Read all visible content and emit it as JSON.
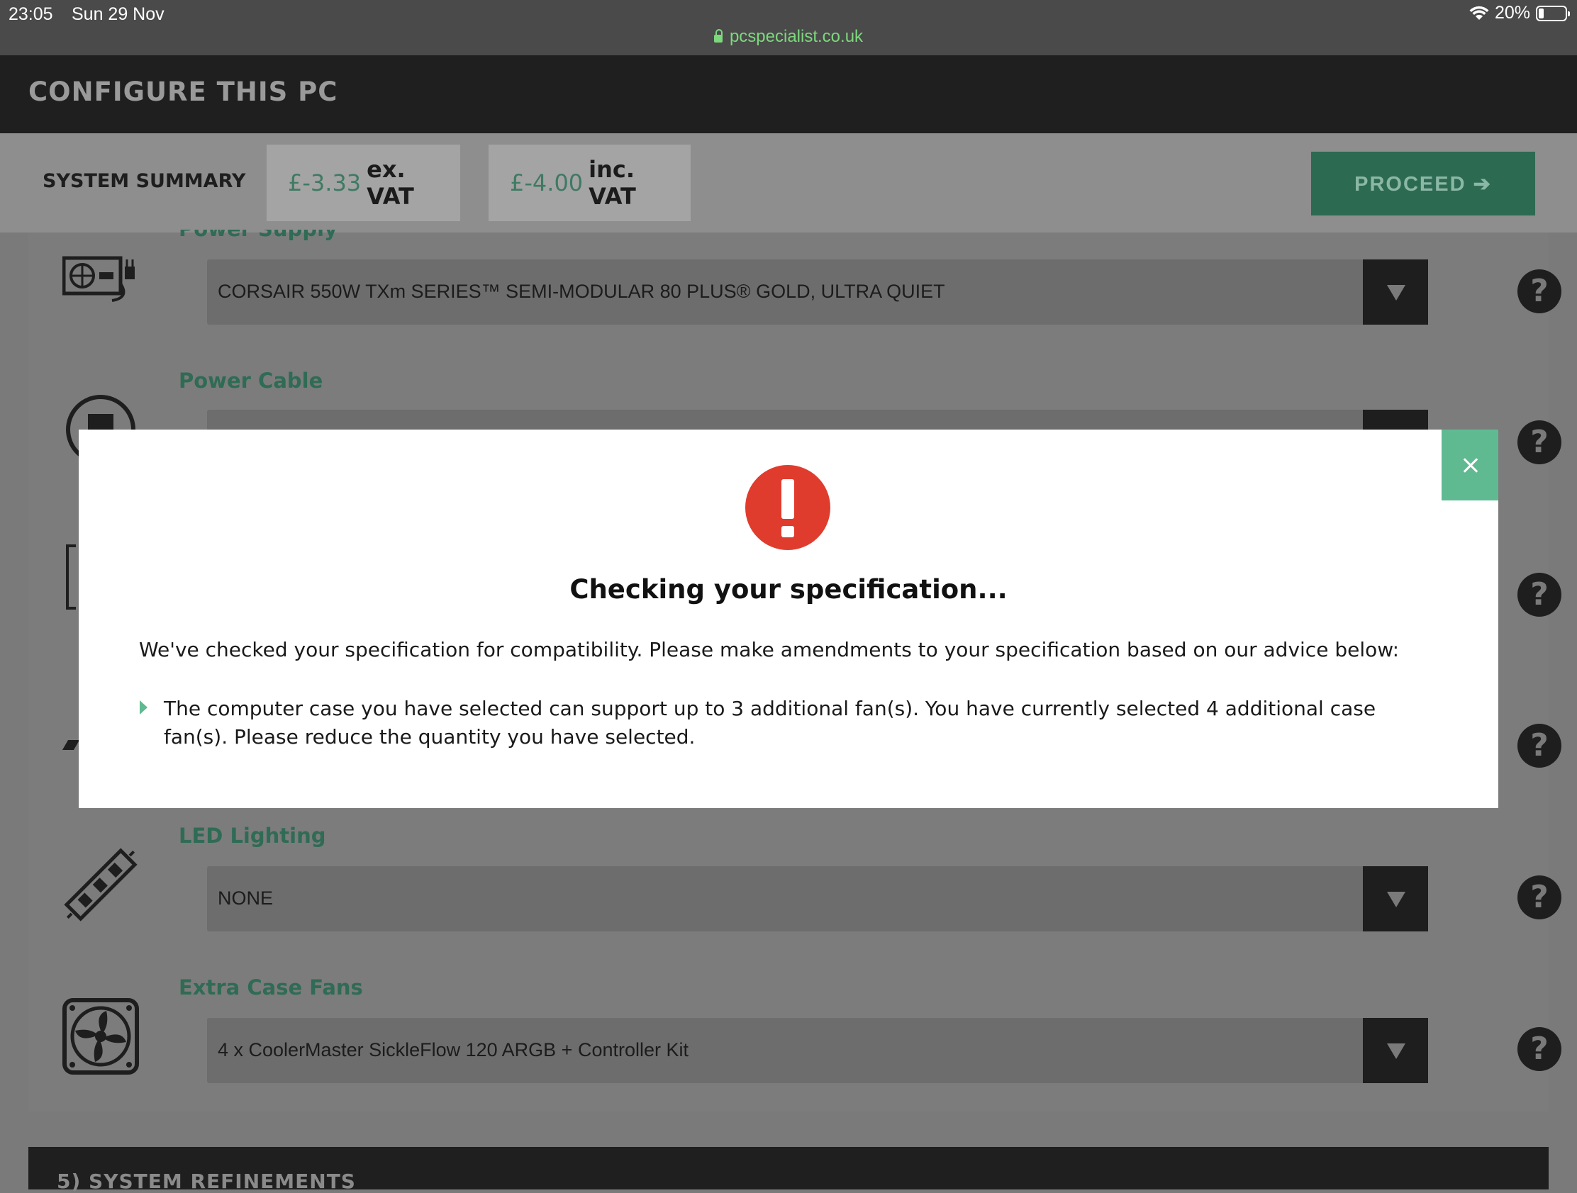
{
  "status_bar": {
    "time": "23:05",
    "date": "Sun 29 Nov",
    "battery": "20%",
    "battery_level": 0.2,
    "url": "pcspecialist.co.uk"
  },
  "header": {
    "title": "CONFIGURE THIS PC"
  },
  "summary": {
    "label": "SYSTEM SUMMARY",
    "ex_vat_amount": "£-3.33",
    "ex_vat_label": "ex. VAT",
    "inc_vat_amount": "£-4.00",
    "inc_vat_label": "inc. VAT",
    "proceed_label": "PROCEED ➔"
  },
  "components": [
    {
      "label": "Power Supply",
      "value": "CORSAIR 550W TXm SERIES™ SEMI-MODULAR 80 PLUS® GOLD, ULTRA QUIET"
    },
    {
      "label": "Power Cable",
      "value": ""
    },
    {
      "label": "LED Lighting",
      "value": "NONE"
    },
    {
      "label": "Extra Case Fans",
      "value": "4 x CoolerMaster SickleFlow 120 ARGB + Controller Kit"
    }
  ],
  "help_label": "?",
  "next_section": "5) SYSTEM REFINEMENTS",
  "modal": {
    "title": "Checking your specification...",
    "intro": "We've checked your specification for compatibility. Please make amendments to your specification based on our advice below:",
    "advice": "The computer case you have selected can support up to 3 additional fan(s). You have currently selected 4 additional case fan(s). Please reduce the quantity you have selected."
  },
  "colors": {
    "accent_green": "#5fba91",
    "alert_red": "#e03c2e",
    "url_green": "#7dd87d"
  }
}
